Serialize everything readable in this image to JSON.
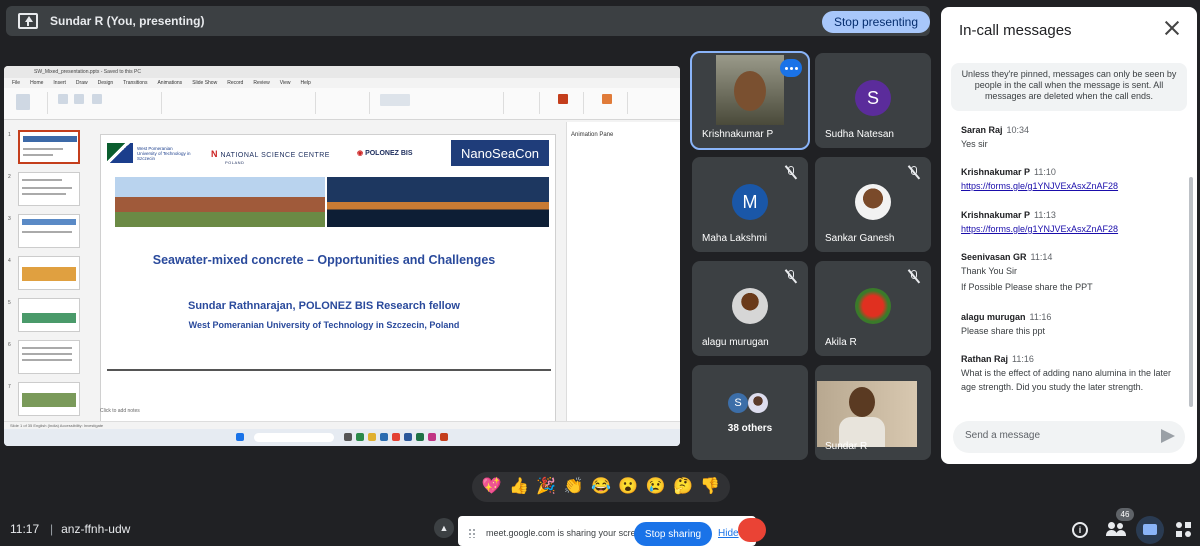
{
  "header": {
    "presenting_label": "Sundar R (You, presenting)",
    "stop_presenting": "Stop presenting"
  },
  "presentation": {
    "window_title": "SW_Mixed_presentation.pptx - Saved to this PC",
    "menu": [
      "File",
      "Home",
      "Insert",
      "Draw",
      "Design",
      "Transitions",
      "Animations",
      "Slide Show",
      "Record",
      "Review",
      "View",
      "Help"
    ],
    "slide": {
      "logo_university": "West Pomeranian University of Technology in Szczecin",
      "logo_ncn": "NATIONAL SCIENCE CENTRE",
      "logo_ncn_sub": "POLAND",
      "logo_polonez": "POLONEZ BIS",
      "logo_nano": "NanoSeaCon",
      "title": "Seawater-mixed concrete – Opportunities and Challenges",
      "author": "Sundar Rathnarajan, POLONEZ BIS Research fellow",
      "affiliation": "West Pomeranian University of Technology in Szczecin, Poland"
    },
    "animation_pane": "Animation Pane",
    "notes_placeholder": "Click to add notes",
    "status": "Slide 1 of 35   English (India)   Accessibility: Investigate"
  },
  "participants": [
    {
      "name": "Krishnakumar P",
      "type": "video",
      "active": true
    },
    {
      "name": "Sudha Natesan",
      "initial": "S",
      "avatar_color": "#5b2c9b",
      "muted": false
    },
    {
      "name": "Maha Lakshmi",
      "initial": "M",
      "avatar_color": "#1a57a8",
      "muted": true
    },
    {
      "name": "Sankar Ganesh",
      "type": "photo",
      "muted": true
    },
    {
      "name": "alagu murugan",
      "type": "photo",
      "muted": true
    },
    {
      "name": "Akila R",
      "type": "photo",
      "muted": true
    },
    {
      "name": "38 others",
      "initial": "S",
      "avatar_color": "#3c6ea8"
    },
    {
      "name": "Sundar R",
      "type": "video"
    }
  ],
  "chat": {
    "title": "In-call messages",
    "notice": "Unless they're pinned, messages can only be seen by people in the call when the message is sent. All messages are deleted when the call ends.",
    "messages": [
      {
        "sender": "Saran Raj",
        "time": "10:34",
        "lines": [
          "Yes sir"
        ]
      },
      {
        "sender": "Krishnakumar P",
        "time": "11:10",
        "link": "https://forms.gle/g1YNJVExAsxZnAF28"
      },
      {
        "sender": "Krishnakumar P",
        "time": "11:13",
        "link": "https://forms.gle/g1YNJVExAsxZnAF28"
      },
      {
        "sender": "Seenivasan GR",
        "time": "11:14",
        "lines": [
          "Thank You Sir",
          "If Possible Please share the PPT"
        ]
      },
      {
        "sender": "alagu murugan",
        "time": "11:16",
        "lines": [
          "Please share this ppt"
        ]
      },
      {
        "sender": "Rathan Raj",
        "time": "11:16",
        "lines": [
          "What is the effect of adding nano alumina in the later age strength. Did you study the later strength."
        ]
      }
    ],
    "input_placeholder": "Send a message"
  },
  "reactions": [
    "💖",
    "👍",
    "🎉",
    "👏",
    "😂",
    "😮",
    "😢",
    "🤔",
    "👎"
  ],
  "bottom": {
    "time": "11:17",
    "meeting_code": "anz-ffnh-udw",
    "share_text": "meet.google.com is sharing your screen.",
    "stop_sharing": "Stop sharing",
    "hide": "Hide",
    "people_count": "46"
  }
}
